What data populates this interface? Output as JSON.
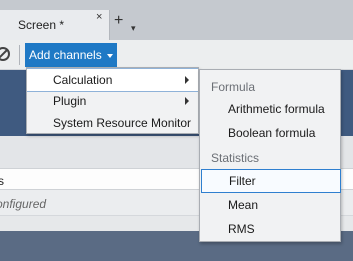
{
  "tabs": {
    "active_label": "Screen *",
    "close_glyph": "×",
    "add_glyph": "+",
    "add_caret": "▾"
  },
  "toolbar": {
    "add_channels_label": "Add channels"
  },
  "table": {
    "column_header": "s",
    "row_text": "onfigured"
  },
  "menu": {
    "items": [
      {
        "label": "Calculation",
        "has_submenu": true
      },
      {
        "label": "Plugin",
        "has_submenu": true
      },
      {
        "label": "System Resource Monitor",
        "has_submenu": false
      }
    ]
  },
  "submenu": {
    "formula_heading": "Formula",
    "formula_items": [
      "Arithmetic formula",
      "Boolean formula"
    ],
    "statistics_heading": "Statistics",
    "statistics_items": [
      "Filter",
      "Mean",
      "RMS"
    ],
    "selected": "Filter"
  },
  "colors": {
    "accent": "#1f79c5",
    "panel_dark": "#3f5a80",
    "selection_border": "#2f7fcf"
  }
}
